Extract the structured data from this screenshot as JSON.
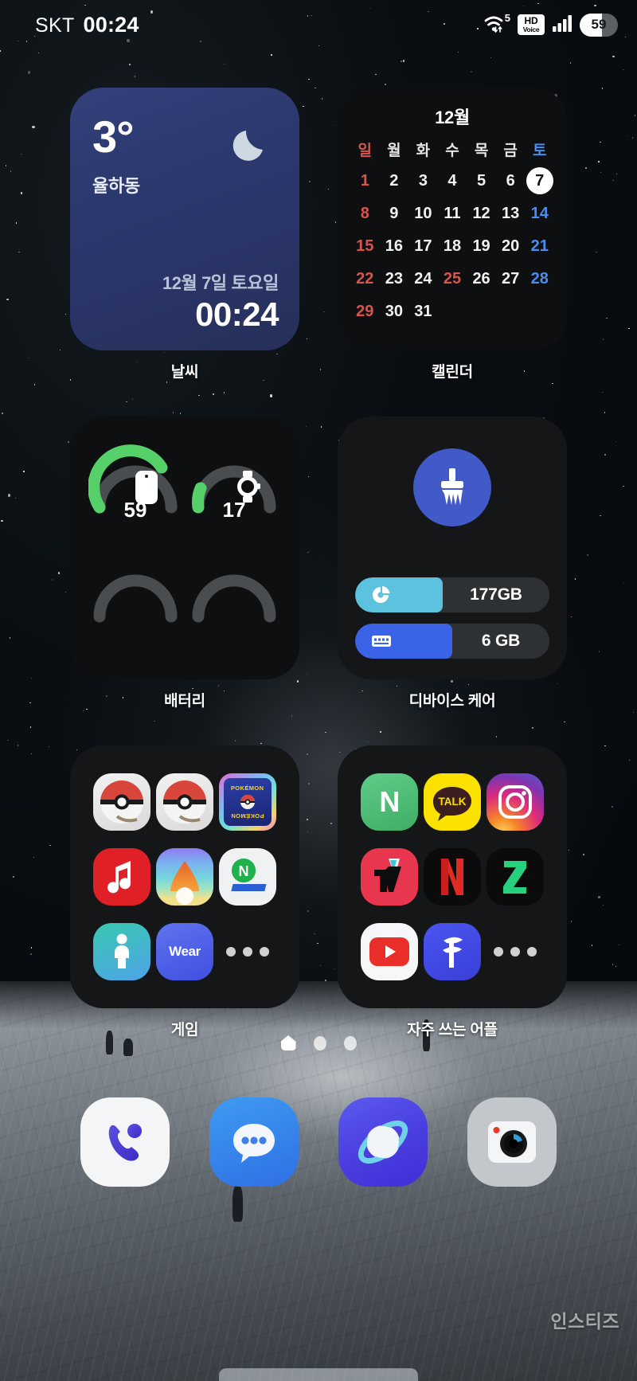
{
  "status_bar": {
    "carrier": "SKT",
    "clock": "00:24",
    "wifi_label": "5",
    "hd_top": "HD",
    "hd_bottom": "Voice",
    "battery_percent": "59"
  },
  "widgets": {
    "weather": {
      "label": "날씨",
      "temperature": "3°",
      "location": "율하동",
      "date": "12월 7일 토요일",
      "time": "00:24",
      "icon": "crescent-moon-icon",
      "bg_color": "#2d3a71"
    },
    "calendar": {
      "label": "캘린더",
      "title": "12월",
      "weekdays": [
        "일",
        "월",
        "화",
        "수",
        "목",
        "금",
        "토"
      ],
      "weeks": [
        [
          {
            "d": "1",
            "t": "sun"
          },
          {
            "d": "2",
            "t": ""
          },
          {
            "d": "3",
            "t": ""
          },
          {
            "d": "4",
            "t": ""
          },
          {
            "d": "5",
            "t": ""
          },
          {
            "d": "6",
            "t": ""
          },
          {
            "d": "7",
            "t": "today"
          }
        ],
        [
          {
            "d": "8",
            "t": "sun"
          },
          {
            "d": "9",
            "t": ""
          },
          {
            "d": "10",
            "t": ""
          },
          {
            "d": "11",
            "t": ""
          },
          {
            "d": "12",
            "t": ""
          },
          {
            "d": "13",
            "t": ""
          },
          {
            "d": "14",
            "t": "sat"
          }
        ],
        [
          {
            "d": "15",
            "t": "sun"
          },
          {
            "d": "16",
            "t": ""
          },
          {
            "d": "17",
            "t": ""
          },
          {
            "d": "18",
            "t": ""
          },
          {
            "d": "19",
            "t": ""
          },
          {
            "d": "20",
            "t": ""
          },
          {
            "d": "21",
            "t": "sat"
          }
        ],
        [
          {
            "d": "22",
            "t": "sun"
          },
          {
            "d": "23",
            "t": ""
          },
          {
            "d": "24",
            "t": ""
          },
          {
            "d": "25",
            "t": "hol"
          },
          {
            "d": "26",
            "t": ""
          },
          {
            "d": "27",
            "t": ""
          },
          {
            "d": "28",
            "t": "sat"
          }
        ],
        [
          {
            "d": "29",
            "t": "sun"
          },
          {
            "d": "30",
            "t": ""
          },
          {
            "d": "31",
            "t": ""
          },
          {
            "d": "",
            "t": "empty"
          },
          {
            "d": "",
            "t": "empty"
          },
          {
            "d": "",
            "t": "empty"
          },
          {
            "d": "",
            "t": "empty"
          }
        ]
      ],
      "today": "7",
      "sunday_color": "#d8544e",
      "saturday_color": "#4a8df0"
    },
    "battery": {
      "label": "배터리",
      "gauges": [
        {
          "device": "phone",
          "value": "59",
          "percent": 59,
          "active": true
        },
        {
          "device": "watch",
          "value": "17",
          "percent": 17,
          "active": true
        },
        {
          "device": "empty-left",
          "value": "",
          "percent": 0,
          "active": false
        },
        {
          "device": "empty-right",
          "value": "",
          "percent": 0,
          "active": false
        }
      ],
      "arc_color": "#56d16a",
      "track_color": "#4a4d50"
    },
    "device_care": {
      "label": "디바이스 케어",
      "icon": "broom-icon",
      "storage_value": "177GB",
      "ram_value": "6 GB",
      "storage_color": "#5cc2dd",
      "ram_color": "#3b63e8",
      "circle_color": "#4259c8"
    },
    "games_folder": {
      "label": "게임",
      "apps": [
        {
          "name": "pokemon-go-1",
          "type": "pokeball"
        },
        {
          "name": "pokemon-go-2",
          "type": "pokeball"
        },
        {
          "name": "pokemon-tcg-pocket",
          "type": "pokemon-card",
          "text": "POKÉMON"
        },
        {
          "name": "melon-music",
          "type": "melon"
        },
        {
          "name": "gradient-app",
          "type": "gradient-drop"
        },
        {
          "name": "naver-map",
          "type": "naver-map",
          "text": "N"
        },
        {
          "name": "samsung-health",
          "type": "health"
        },
        {
          "name": "galaxy-wearable",
          "type": "wear",
          "text": "Wear"
        },
        {
          "name": "more-apps",
          "type": "more"
        }
      ]
    },
    "frequent_folder": {
      "label": "자주 쓰는 어플",
      "apps": [
        {
          "name": "naver",
          "type": "naver",
          "text": "N"
        },
        {
          "name": "kakaotalk",
          "type": "kakao",
          "text": "TALK"
        },
        {
          "name": "instagram",
          "type": "instagram"
        },
        {
          "name": "tving",
          "type": "tving"
        },
        {
          "name": "netflix",
          "type": "netflix",
          "text": "N"
        },
        {
          "name": "zigbang",
          "type": "zigbang",
          "text": "Z"
        },
        {
          "name": "youtube",
          "type": "youtube"
        },
        {
          "name": "flitto",
          "type": "flitto"
        },
        {
          "name": "more-apps",
          "type": "more"
        }
      ]
    }
  },
  "page_indicator": {
    "pages": 3,
    "active_index": 0,
    "home_icon": "home-icon"
  },
  "dock": {
    "apps": [
      {
        "name": "phone",
        "type": "phone"
      },
      {
        "name": "messages",
        "type": "messages"
      },
      {
        "name": "samsung-internet",
        "type": "internet"
      },
      {
        "name": "camera",
        "type": "camera"
      }
    ]
  },
  "watermark": "인스티즈"
}
